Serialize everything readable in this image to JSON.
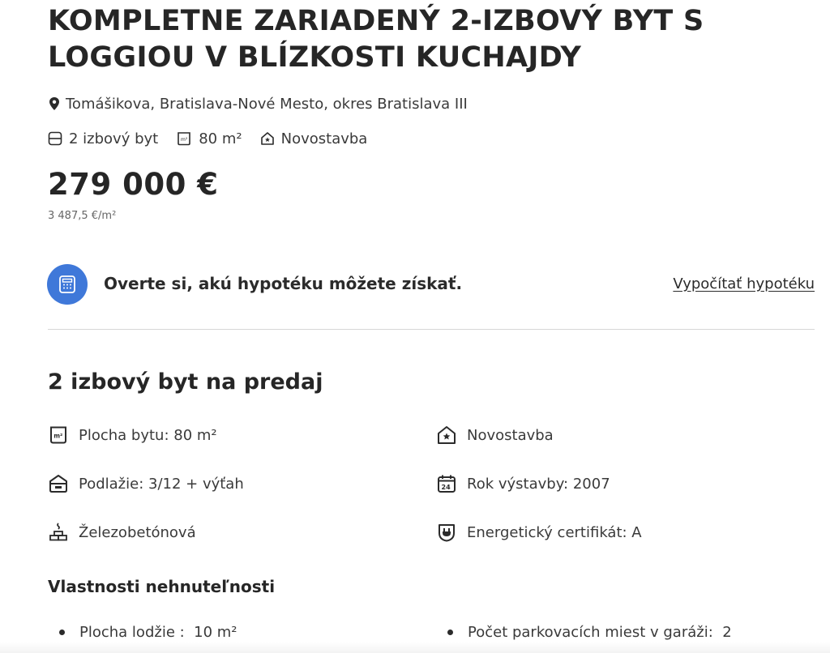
{
  "listing": {
    "title": "KOMPLETNE ZARIADENÝ 2-IZBOVÝ BYT S LOGGIOU V BLÍZKOSTI KUCHAJDY",
    "address": "Tomášikova, Bratislava-Nové Mesto, okres Bratislava III",
    "badges": [
      {
        "label": "2 izbový byt",
        "icon": "rooms-icon"
      },
      {
        "label": "80 m²",
        "icon": "area-icon"
      },
      {
        "label": "Novostavba",
        "icon": "new-building-icon"
      }
    ],
    "price": "279 000 €",
    "price_per_m2": "3 487,5 €/m²"
  },
  "mortgage": {
    "text": "Overte si, akú hypotéku môžete získať.",
    "link_label": "Vypočítať hypotéku",
    "icon": "calculator-icon",
    "accent_color": "#3f78d9"
  },
  "details": {
    "section_title": "2 izbový byt na predaj",
    "features_left": [
      {
        "label": "Plocha bytu: 80 m²",
        "icon": "area-icon"
      },
      {
        "label": "Podlažie: 3/12 + výťah",
        "icon": "elevator-icon"
      },
      {
        "label": "Železobetónová",
        "icon": "bricks-icon"
      }
    ],
    "features_right": [
      {
        "label": "Novostavba",
        "icon": "new-building-icon"
      },
      {
        "label": "Rok výstavby: 2007",
        "icon": "calendar-icon"
      },
      {
        "label": "Energetický certifikát: A",
        "icon": "energy-plug-icon"
      }
    ],
    "calendar_day": "24"
  },
  "properties": {
    "title": "Vlastnosti nehnuteľnosti",
    "items": [
      "Plocha lodžie :  10 m²",
      "Počet parkovacích miest v garáži:  2"
    ]
  }
}
